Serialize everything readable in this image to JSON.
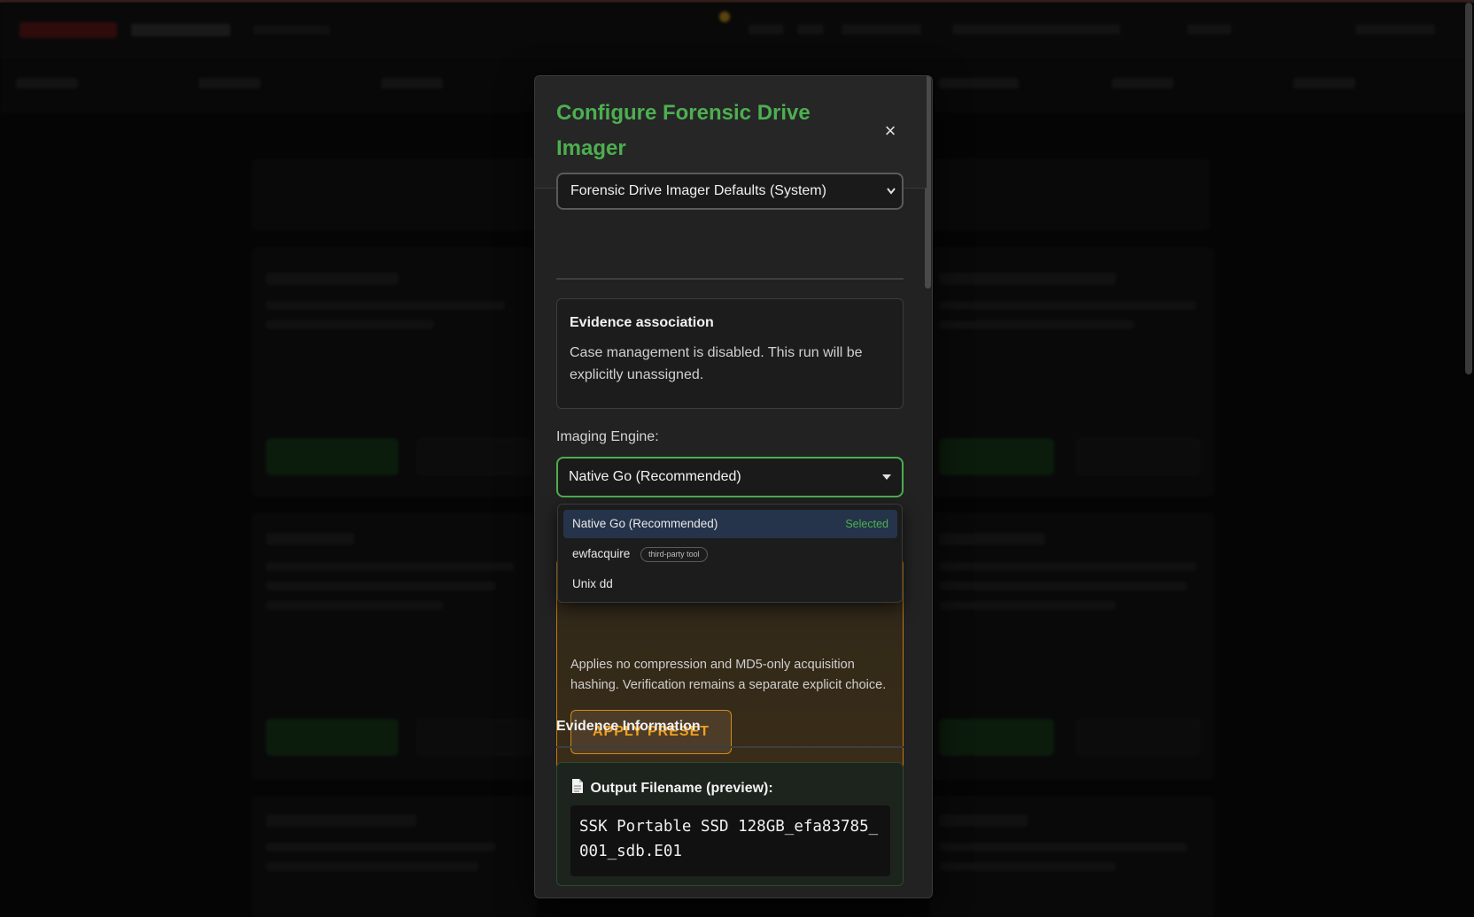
{
  "modal": {
    "title": "Configure Forensic Drive Imager",
    "close_symbol": "×",
    "preset_select_value": "Forensic Drive Imager Defaults (System)",
    "evidence_association": {
      "heading": "Evidence association",
      "text": "Case management is disabled. This run will be explicitly unassigned."
    },
    "engine": {
      "label": "Imaging Engine:",
      "value": "Native Go (Recommended)",
      "options": [
        {
          "label": "Native Go (Recommended)",
          "badge": "Selected",
          "tag": ""
        },
        {
          "label": "ewfacquire",
          "badge": "",
          "tag": "third-party tool"
        },
        {
          "label": "Unix dd",
          "badge": "",
          "tag": ""
        }
      ]
    },
    "preset_card": {
      "description": "Applies no compression and MD5-only acquisition hashing. Verification remains a separate explicit choice.",
      "apply_label": "APPLY PRESET"
    },
    "evidence_information": {
      "heading": "Evidence Information",
      "filename_label": "Output Filename (preview):",
      "filename_value": "SSK Portable SSD 128GB_efa83785_001_sdb.E01"
    }
  },
  "colors": {
    "accent_green": "#4caf50",
    "warning_orange": "#f0a020",
    "modal_bg": "#222222"
  },
  "icons": {
    "close": "close-icon",
    "document": "document-icon",
    "select_caret": "chevron-down-icon"
  }
}
